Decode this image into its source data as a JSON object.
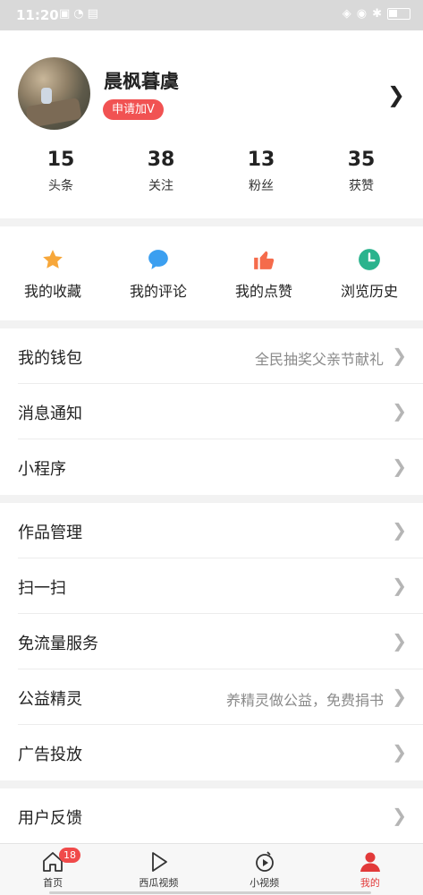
{
  "status_bar": {
    "time": "11:20",
    "left_icons": [
      "wechat-icon",
      "wifi-icon",
      "hd-icon"
    ],
    "right_icons": [
      "nfc-icon",
      "location-icon",
      "bluetooth-icon",
      "battery-icon"
    ]
  },
  "profile": {
    "username": "晨枫暮虞",
    "badge": "申请加V"
  },
  "stats": [
    {
      "num": "15",
      "label": "头条"
    },
    {
      "num": "38",
      "label": "关注"
    },
    {
      "num": "13",
      "label": "粉丝"
    },
    {
      "num": "35",
      "label": "获赞"
    }
  ],
  "quick_actions": [
    {
      "label": "我的收藏",
      "icon": "star-icon",
      "color": "#f7a73a"
    },
    {
      "label": "我的评论",
      "icon": "comment-icon",
      "color": "#3b9ff0"
    },
    {
      "label": "我的点赞",
      "icon": "thumbs-up-icon",
      "color": "#f56b4b"
    },
    {
      "label": "浏览历史",
      "icon": "clock-icon",
      "color": "#2ab38d"
    }
  ],
  "menu_group1": [
    {
      "label": "我的钱包",
      "extra": "全民抽奖父亲节献礼"
    },
    {
      "label": "消息通知",
      "extra": ""
    },
    {
      "label": "小程序",
      "extra": ""
    }
  ],
  "menu_group2": [
    {
      "label": "作品管理",
      "extra": ""
    },
    {
      "label": "扫一扫",
      "extra": ""
    },
    {
      "label": "免流量服务",
      "extra": ""
    },
    {
      "label": "公益精灵",
      "extra": "养精灵做公益，免费捐书"
    },
    {
      "label": "广告投放",
      "extra": ""
    }
  ],
  "menu_group3": [
    {
      "label": "用户反馈",
      "extra": ""
    }
  ],
  "tabbar": [
    {
      "label": "首页",
      "icon": "home-icon",
      "badge": "18"
    },
    {
      "label": "西瓜视频",
      "icon": "play-icon",
      "badge": ""
    },
    {
      "label": "小视频",
      "icon": "short-video-icon",
      "badge": ""
    },
    {
      "label": "我的",
      "icon": "person-icon",
      "badge": ""
    }
  ],
  "colors": {
    "accent": "#f15252",
    "active_tab": "#e23a3a"
  }
}
